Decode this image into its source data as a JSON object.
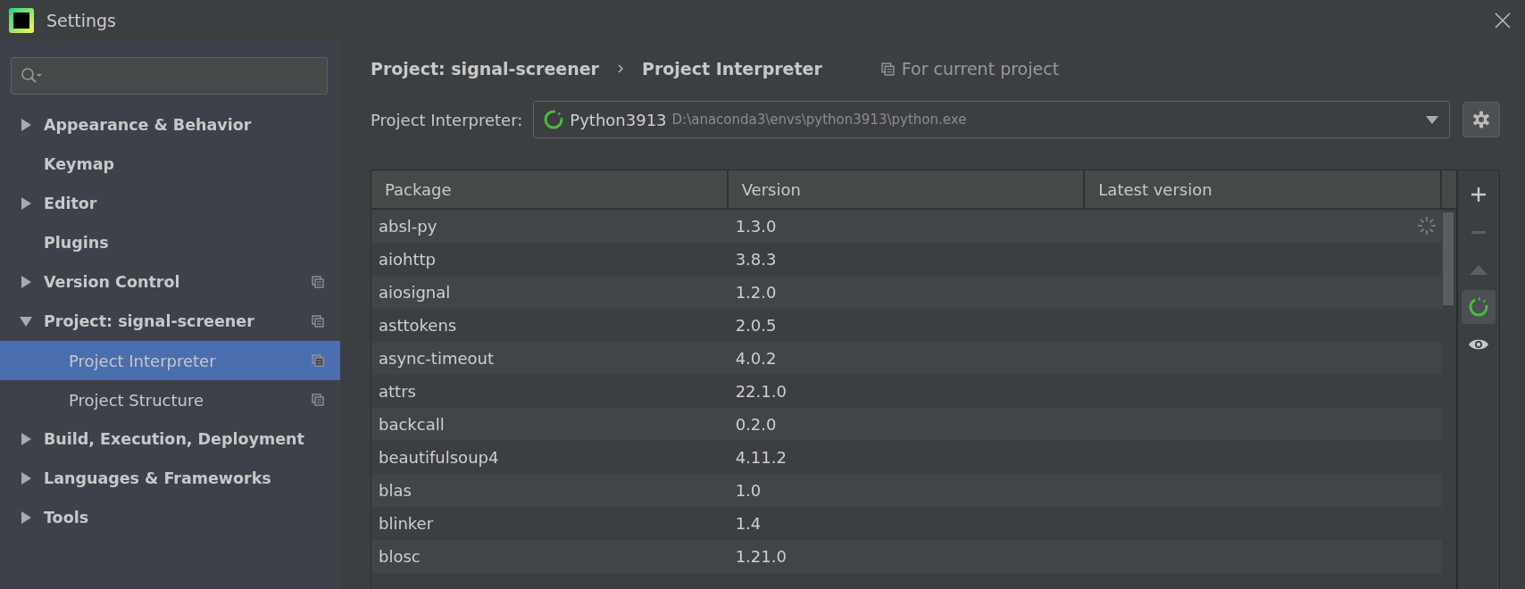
{
  "window": {
    "title": "Settings"
  },
  "sidebar": {
    "items": [
      {
        "label": "Appearance & Behavior",
        "kind": "group",
        "expanded": false,
        "selected": false,
        "project_scoped": false
      },
      {
        "label": "Keymap",
        "kind": "page",
        "expanded": false,
        "selected": false,
        "project_scoped": false
      },
      {
        "label": "Editor",
        "kind": "group",
        "expanded": false,
        "selected": false,
        "project_scoped": false
      },
      {
        "label": "Plugins",
        "kind": "page",
        "expanded": false,
        "selected": false,
        "project_scoped": false
      },
      {
        "label": "Version Control",
        "kind": "group",
        "expanded": false,
        "selected": false,
        "project_scoped": true
      },
      {
        "label": "Project: signal-screener",
        "kind": "group",
        "expanded": true,
        "selected": false,
        "project_scoped": true,
        "children": [
          {
            "label": "Project Interpreter",
            "selected": true,
            "project_scoped": true
          },
          {
            "label": "Project Structure",
            "selected": false,
            "project_scoped": true
          }
        ]
      },
      {
        "label": "Build, Execution, Deployment",
        "kind": "group",
        "expanded": false,
        "selected": false,
        "project_scoped": false
      },
      {
        "label": "Languages & Frameworks",
        "kind": "group",
        "expanded": false,
        "selected": false,
        "project_scoped": false
      },
      {
        "label": "Tools",
        "kind": "group",
        "expanded": false,
        "selected": false,
        "project_scoped": false
      }
    ]
  },
  "breadcrumb": [
    "Project: signal-screener",
    "Project Interpreter"
  ],
  "scope_note": "For current project",
  "interpreter": {
    "label": "Project Interpreter:",
    "name": "Python3913",
    "path": "D:\\anaconda3\\envs\\python3913\\python.exe"
  },
  "table": {
    "columns": [
      "Package",
      "Version",
      "Latest version"
    ],
    "rows": [
      [
        "absl-py",
        "1.3.0",
        ""
      ],
      [
        "aiohttp",
        "3.8.3",
        ""
      ],
      [
        "aiosignal",
        "1.2.0",
        ""
      ],
      [
        "asttokens",
        "2.0.5",
        ""
      ],
      [
        "async-timeout",
        "4.0.2",
        ""
      ],
      [
        "attrs",
        "22.1.0",
        ""
      ],
      [
        "backcall",
        "0.2.0",
        ""
      ],
      [
        "beautifulsoup4",
        "4.11.2",
        ""
      ],
      [
        "blas",
        "1.0",
        ""
      ],
      [
        "blinker",
        "1.4",
        ""
      ],
      [
        "blosc",
        "1.21.0",
        ""
      ]
    ]
  },
  "toolbar": [
    {
      "kind": "add",
      "disabled": false,
      "selected": false
    },
    {
      "kind": "remove",
      "disabled": true,
      "selected": false
    },
    {
      "kind": "upgrade",
      "disabled": true,
      "selected": false
    },
    {
      "kind": "conda",
      "disabled": false,
      "selected": true
    },
    {
      "kind": "eye",
      "disabled": false,
      "selected": false
    }
  ]
}
